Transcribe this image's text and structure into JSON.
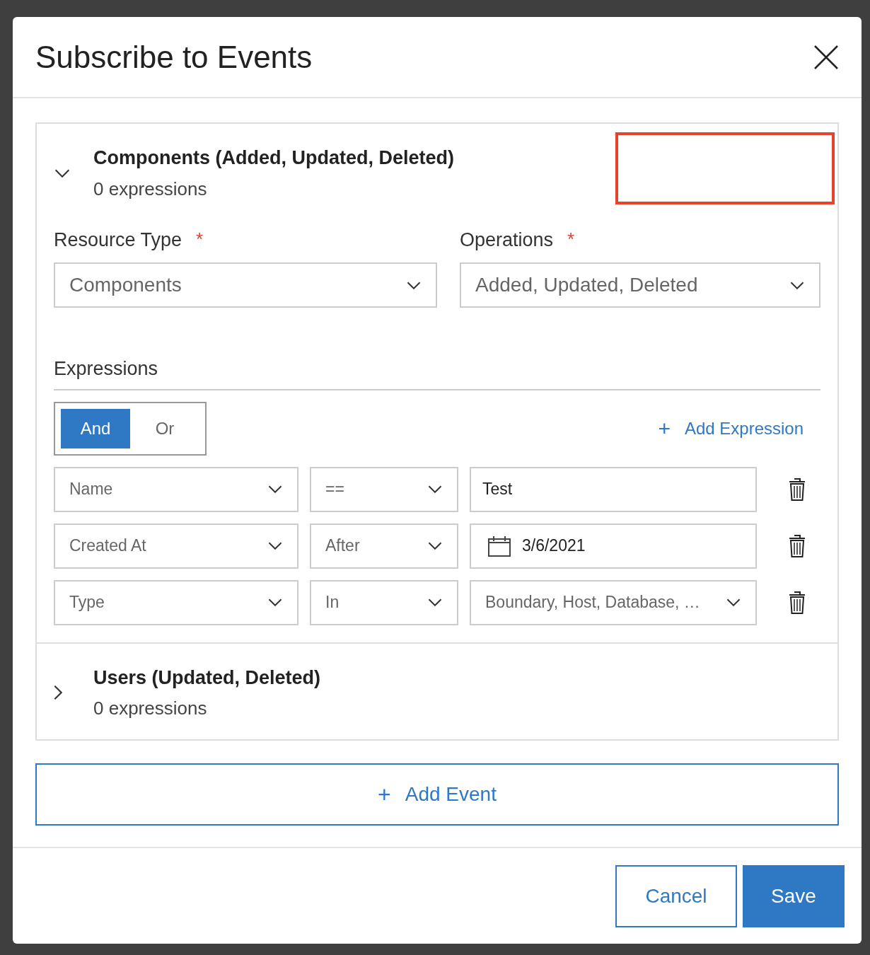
{
  "dialog": {
    "title": "Subscribe to Events"
  },
  "events": [
    {
      "title": "Components (Added, Updated, Deleted)",
      "subtitle": "0 expressions",
      "expanded": true,
      "resource_type": {
        "label": "Resource Type",
        "required_mark": "*",
        "value": "Components"
      },
      "operations": {
        "label": "Operations",
        "required_mark": "*",
        "value": "Added,  Updated,  Deleted"
      },
      "expressions_label": "Expressions",
      "logic": [
        {
          "label": "And",
          "selected": true
        },
        {
          "label": "Or",
          "selected": false
        }
      ],
      "add_expression": {
        "icon": "+",
        "label": "Add Expression"
      },
      "rows": [
        {
          "field": "Name",
          "operator": "==",
          "value": {
            "kind": "text",
            "text": "Test"
          }
        },
        {
          "field": "Created At",
          "operator": "After",
          "value": {
            "kind": "date",
            "text": "3/6/2021"
          }
        },
        {
          "field": "Type",
          "operator": "In",
          "value": {
            "kind": "select",
            "text": "Boundary, Host, Database, …"
          }
        }
      ]
    },
    {
      "title": "Users (Updated, Deleted)",
      "subtitle": "0 expressions",
      "expanded": false
    }
  ],
  "add_event": {
    "icon": "+",
    "label": "Add Event"
  },
  "buttons": {
    "cancel": "Cancel",
    "save": "Save"
  }
}
